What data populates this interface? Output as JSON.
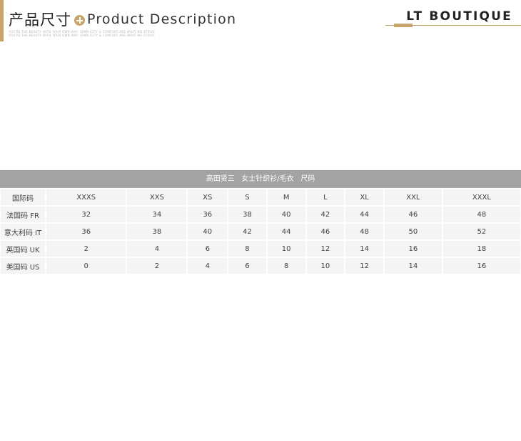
{
  "header": {
    "title_cn": "产品尺寸",
    "title_en": "Product Description",
    "fine_print": [
      "YOU’RE THE BEAUTY WITH YOUR OWN WAY; SIMPLICITY & COMFORT ARE WHAT WE STRIVE FOR; LET SIMPLE BE",
      "YOU’RE THE BEAUTY WITH YOUR OWN WAY; SIMPLICITY & COMFORT ARE WHAT WE STRIVE FOR; LET SIMPLE BE"
    ],
    "brand": "LT BOUTIQUE",
    "accent_color": "#c8a46a"
  },
  "size_table": {
    "title": "高田贤三   女士针织衫/毛衣   尺码",
    "header_label": "国际码",
    "sizes": [
      "XXXS",
      "XXS",
      "XS",
      "S",
      "M",
      "L",
      "XL",
      "XXL",
      "XXXL"
    ],
    "rows": [
      {
        "label": "法国码 FR",
        "values": [
          "32",
          "34",
          "36",
          "38",
          "40",
          "42",
          "44",
          "46",
          "48"
        ]
      },
      {
        "label": "意大利码 IT",
        "values": [
          "36",
          "38",
          "40",
          "42",
          "44",
          "46",
          "48",
          "50",
          "52"
        ]
      },
      {
        "label": "英国码 UK",
        "values": [
          "2",
          "4",
          "6",
          "8",
          "10",
          "12",
          "14",
          "16",
          "18"
        ]
      },
      {
        "label": "美国码 US",
        "values": [
          "0",
          "2",
          "4",
          "6",
          "8",
          "10",
          "12",
          "14",
          "16"
        ]
      }
    ],
    "title_bg": "#a3a3a3",
    "cell_bg": "#f4f4f4"
  }
}
